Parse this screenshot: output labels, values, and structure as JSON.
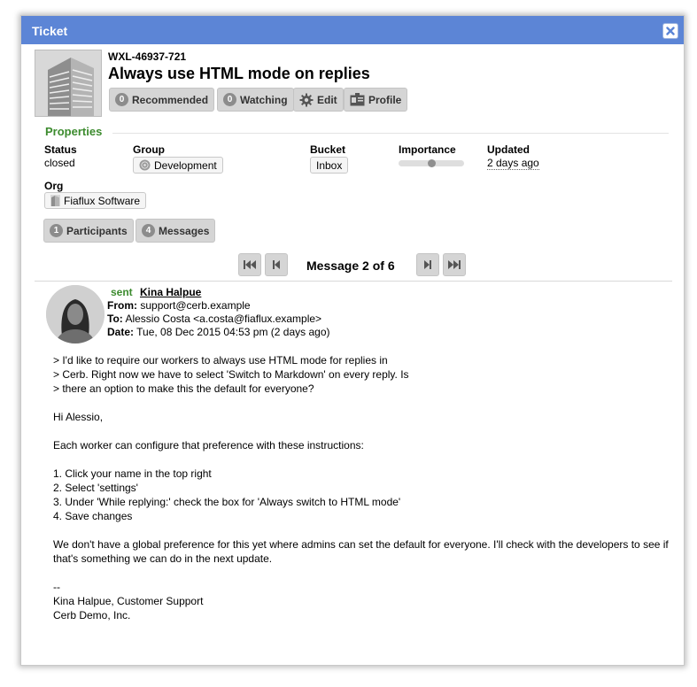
{
  "dialog": {
    "title": "Ticket"
  },
  "ticket": {
    "mask": "WXL-46937-721",
    "subject": "Always use HTML mode on replies"
  },
  "toolbar": {
    "recommended": {
      "count": "0",
      "label": "Recommended"
    },
    "watching": {
      "count": "0",
      "label": "Watching"
    },
    "edit_label": "Edit",
    "profile_label": "Profile"
  },
  "properties": {
    "title": "Properties",
    "status": {
      "label": "Status",
      "value": "closed"
    },
    "group": {
      "label": "Group",
      "value": "Development"
    },
    "bucket": {
      "label": "Bucket",
      "value": "Inbox"
    },
    "importance": {
      "label": "Importance",
      "level_percent": 50
    },
    "updated": {
      "label": "Updated",
      "value": "2 days ago"
    },
    "org": {
      "label": "Org",
      "value": "Fiaflux Software"
    }
  },
  "tabs": {
    "participants": {
      "count": "1",
      "label": "Participants"
    },
    "messages": {
      "count": "4",
      "label": "Messages"
    }
  },
  "pager": {
    "label": "Message 2 of 6"
  },
  "message": {
    "status": "sent",
    "sender": "Kina Halpue",
    "from_label": "From:",
    "from": "support@cerb.example",
    "to_label": "To:",
    "to": "Alessio Costa <a.costa@fiaflux.example>",
    "date_label": "Date:",
    "date": "Tue, 08 Dec 2015 04:53 pm (2 days ago)",
    "body_lines": [
      "> I'd like to require our workers to always use HTML mode for replies in",
      "> Cerb. Right now we have to select 'Switch to Markdown' on every reply. Is",
      "> there an option to make this the default for everyone?",
      "Hi Alessio,",
      "Each worker can configure that preference with these instructions:",
      "1. Click your name in the top right",
      "2. Select 'settings'",
      "3. Under 'While replying:' check the box for 'Always switch to HTML mode'",
      "4. Save changes",
      "We don't have a global preference for this yet where admins can set the default for everyone. I'll check with the developers to see if",
      "that's something we can do in the next update.",
      "--",
      "Kina Halpue, Customer Support",
      "Cerb Demo, Inc."
    ]
  }
}
